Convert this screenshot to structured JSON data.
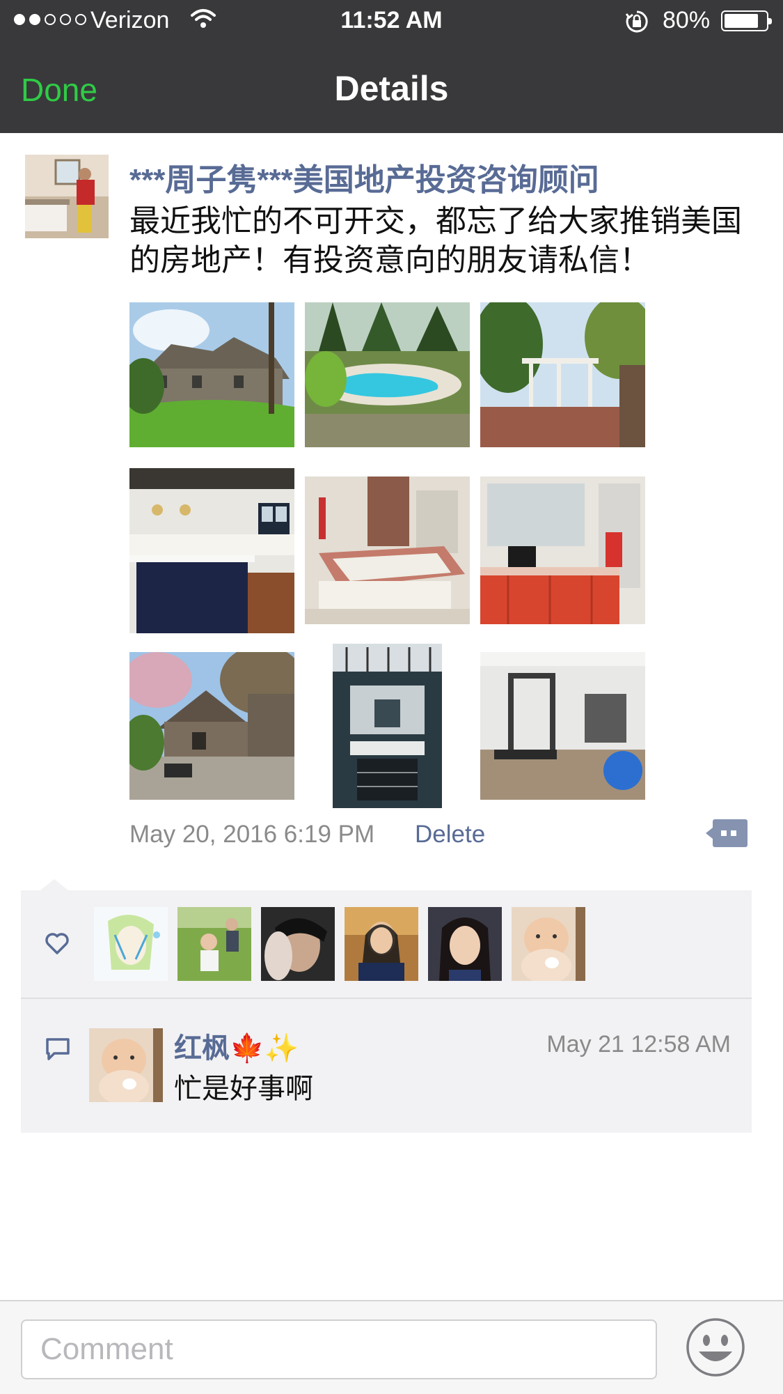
{
  "status_bar": {
    "carrier": "Verizon",
    "time": "11:52 AM",
    "battery": "80%",
    "battery_level": 0.8,
    "signal_bars": 2
  },
  "nav": {
    "done_label": "Done",
    "title": "Details"
  },
  "post": {
    "author": "***周子隽***美国地产投资咨询顾问",
    "text": "最近我忙的不可开交，都忘了给大家推销美国的房地产！有投资意向的朋友请私信！",
    "date": "May 20, 2016 6:19 PM",
    "delete_label": "Delete",
    "photos": [
      "house-exterior-lawn",
      "pool",
      "garden-pergola",
      "kitchen",
      "bathroom-tub",
      "bathroom-vanity",
      "house-patio",
      "stairwell",
      "home-gym"
    ]
  },
  "likes": {
    "icon": "heart-icon",
    "avatars": [
      "avatar-anime",
      "avatar-child",
      "avatar-man",
      "avatar-woman-cafe",
      "avatar-woman",
      "avatar-baby"
    ]
  },
  "comment": {
    "icon": "comment-icon",
    "name": "红枫🍁✨",
    "time": "May 21 12:58 AM",
    "text": "忙是好事啊"
  },
  "composer": {
    "placeholder": "Comment",
    "emoji_icon": "smiley-icon"
  },
  "colors": {
    "nav_bg": "#39393b",
    "done_green": "#2fcc46",
    "link_blue": "#586b95",
    "panel_bg": "#f2f2f4"
  }
}
